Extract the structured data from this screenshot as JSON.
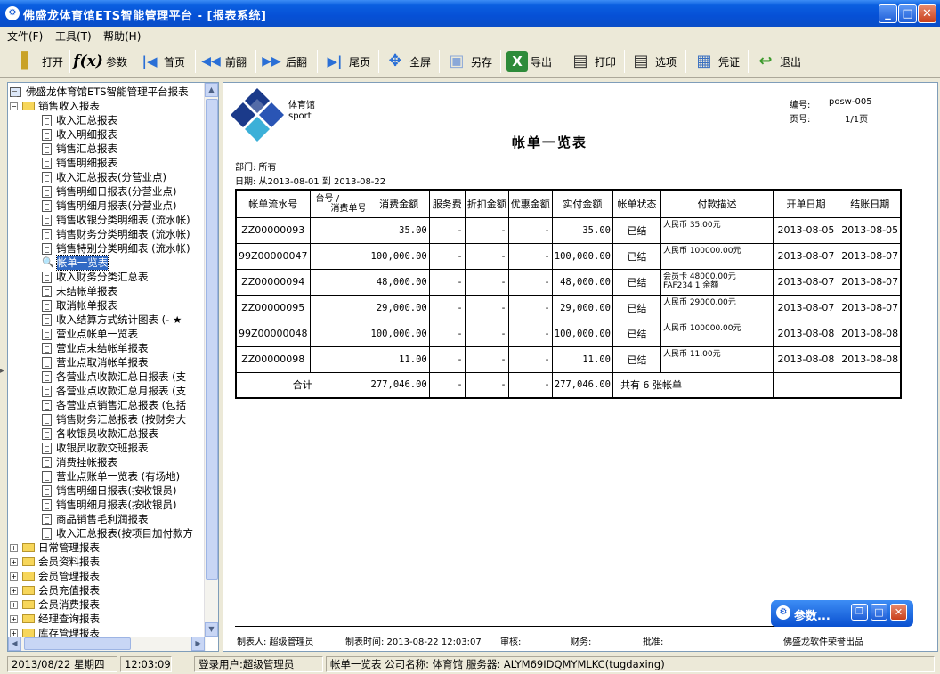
{
  "window": {
    "title": "佛盛龙体育馆ETS智能管理平台 - [报表系统]",
    "minimize_glyph": "_",
    "maximize_glyph": "□",
    "close_glyph": "✕"
  },
  "menu": [
    "文件(F)",
    "工具(T)",
    "帮助(H)"
  ],
  "toolbar": [
    {
      "label": "打开",
      "icon": "folder-open-icon",
      "glyph": "▌"
    },
    {
      "label": "参数",
      "icon": "fx-icon",
      "glyph": "f(x)"
    },
    {
      "label": "首页",
      "icon": "first-page-icon",
      "glyph": "|◀"
    },
    {
      "label": "前翻",
      "icon": "previous-page-icon",
      "glyph": "◀◀"
    },
    {
      "label": "后翻",
      "icon": "next-page-icon",
      "glyph": "▶▶"
    },
    {
      "label": "尾页",
      "icon": "last-page-icon",
      "glyph": "▶|"
    },
    {
      "label": "全屏",
      "icon": "fullscreen-icon",
      "glyph": "✥"
    },
    {
      "label": "另存",
      "icon": "save-as-icon",
      "glyph": "▣"
    },
    {
      "label": "导出",
      "icon": "excel-export-icon",
      "glyph": "X"
    },
    {
      "label": "打印",
      "icon": "printer-icon",
      "glyph": "▤"
    },
    {
      "label": "选项",
      "icon": "print-options-icon",
      "glyph": "▤"
    },
    {
      "label": "凭证",
      "icon": "voucher-icon",
      "glyph": "▦"
    },
    {
      "label": "退出",
      "icon": "exit-icon",
      "glyph": "↩"
    }
  ],
  "tree": {
    "root": "佛盛龙体育馆ETS智能管理平台报表",
    "open_group": "销售收入报表",
    "children": [
      "收入汇总报表",
      "收入明细报表",
      "销售汇总报表",
      "销售明细报表",
      "收入汇总报表(分营业点)",
      "销售明细日报表(分营业点)",
      "销售明细月报表(分营业点)",
      "销售收银分类明细表 (流水帐)",
      "销售财务分类明细表 (流水帐)",
      "销售特别分类明细表 (流水帐)",
      "帐单一览表",
      "收入财务分类汇总表",
      "未结帐单报表",
      "取消帐单报表",
      "收入结算方式统计图表 (- ★",
      "营业点帐单一览表",
      "营业点未结帐单报表",
      "营业点取消帐单报表",
      "各营业点收款汇总日报表 (支",
      "各营业点收款汇总月报表 (支",
      "各营业点销售汇总报表 (包括",
      "销售财务汇总报表 (按财务大",
      "各收银员收款汇总报表",
      "收银员收款交班报表",
      "消费挂帐报表",
      "营业点账单一览表 (有场地)",
      "销售明细日报表(按收银员)",
      "销售明细月报表(按收银员)",
      "商品销售毛利润报表",
      "收入汇总报表(按项目加付款方"
    ],
    "selected_index": 10,
    "collapsed_groups": [
      "日常管理报表",
      "会员资料报表",
      "会员管理报表",
      "会员充值报表",
      "会员消费报表",
      "经理查询报表",
      "库存管理报表"
    ]
  },
  "report": {
    "logo_text_1": "体育馆",
    "logo_text_2": "sport",
    "serial_label": "编号:",
    "serial_value": "posw-005",
    "page_label": "页号:",
    "page_value": "1/1页",
    "title": "帐单一览表",
    "dept_line": "部门: 所有",
    "date_line": "日期: 从2013-08-01 到 2013-08-22",
    "headers": [
      "帐单流水号",
      "台号 / 消费单号",
      "消费金额",
      "服务费",
      "折扣金额",
      "优惠金额",
      "实付金额",
      "帐单状态",
      "付款描述",
      "开单日期",
      "结账日期"
    ],
    "header_card_top": "台号 /",
    "header_card_bottom": "消费单号",
    "rows": [
      {
        "bill_no": "ZZ00000093",
        "table_no": "",
        "amount": "35.00",
        "service": "-",
        "discount": "-",
        "promo": "-",
        "paid": "35.00",
        "status": "已结",
        "pay_desc": [
          "人民币 35.00元"
        ],
        "open_date": "2013-08-05",
        "close_date": "2013-08-05"
      },
      {
        "bill_no": "99Z00000047",
        "table_no": "",
        "amount": "100,000.00",
        "service": "-",
        "discount": "-",
        "promo": "-",
        "paid": "100,000.00",
        "status": "已结",
        "pay_desc": [
          "人民币 100000.00元"
        ],
        "open_date": "2013-08-07",
        "close_date": "2013-08-07"
      },
      {
        "bill_no": "ZZ00000094",
        "table_no": "",
        "amount": "48,000.00",
        "service": "-",
        "discount": "-",
        "promo": "-",
        "paid": "48,000.00",
        "status": "已结",
        "pay_desc": [
          "会员卡 48000.00元",
          "FAF234 1 余额"
        ],
        "open_date": "2013-08-07",
        "close_date": "2013-08-07"
      },
      {
        "bill_no": "ZZ00000095",
        "table_no": "",
        "amount": "29,000.00",
        "service": "-",
        "discount": "-",
        "promo": "-",
        "paid": "29,000.00",
        "status": "已结",
        "pay_desc": [
          "人民币 29000.00元"
        ],
        "open_date": "2013-08-07",
        "close_date": "2013-08-07"
      },
      {
        "bill_no": "99Z00000048",
        "table_no": "",
        "amount": "100,000.00",
        "service": "-",
        "discount": "-",
        "promo": "-",
        "paid": "100,000.00",
        "status": "已结",
        "pay_desc": [
          "人民币 100000.00元"
        ],
        "open_date": "2013-08-08",
        "close_date": "2013-08-08"
      },
      {
        "bill_no": "ZZ00000098",
        "table_no": "",
        "amount": "11.00",
        "service": "-",
        "discount": "-",
        "promo": "-",
        "paid": "11.00",
        "status": "已结",
        "pay_desc": [
          "人民币 11.00元"
        ],
        "open_date": "2013-08-08",
        "close_date": "2013-08-08"
      }
    ],
    "total": {
      "label": "合计",
      "amount": "277,046.00",
      "service": "-",
      "discount": "-",
      "promo": "-",
      "paid": "277,046.00",
      "summary": "共有  6  张帐单"
    },
    "footer": {
      "maker": "制表人: 超级管理员",
      "make_time": "制表时间: 2013-08-22 12:03:07",
      "auditor": "审核:",
      "finance": "财务:",
      "approver": "批准:",
      "vendor": "佛盛龙软件荣誉出品"
    }
  },
  "param_window": {
    "title": "参数..."
  },
  "status": {
    "date": "2013/08/22 星期四",
    "time": "12:03:09",
    "user": "登录用户:超级管理员",
    "info": "帐单一览表 公司名称: 体育馆 服务器: ALYM69IDQMYMLKC(tugdaxing)"
  }
}
